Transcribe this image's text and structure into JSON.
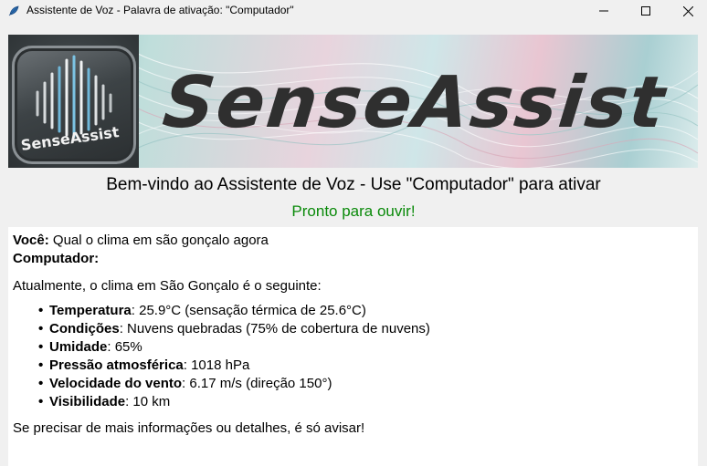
{
  "window": {
    "title": "Assistente de Voz - Palavra de ativação: \"Computador\"",
    "controls": {
      "minimize": "minimize-icon",
      "maximize": "maximize-icon",
      "close": "close-icon"
    }
  },
  "banner": {
    "logo_text": "SenseAssist",
    "title": "SenseAssist"
  },
  "welcome": "Bem-vindo ao Assistente de Voz - Use \"Computador\" para ativar",
  "status": {
    "text": "Pronto para ouvir!",
    "color": "#0a8a0a"
  },
  "chat": {
    "user_label": "Você:",
    "user_message": "Qual o clima em são gonçalo agora",
    "assistant_label": "Computador:",
    "intro": "Atualmente, o clima em São Gonçalo é o seguinte:",
    "details": [
      {
        "label": "Temperatura",
        "value": ": 25.9°C (sensação térmica de 25.6°C)"
      },
      {
        "label": "Condições",
        "value": ": Nuvens quebradas (75% de cobertura de nuvens)"
      },
      {
        "label": "Umidade",
        "value": ": 65%"
      },
      {
        "label": "Pressão atmosférica",
        "value": ": 1018 hPa"
      },
      {
        "label": "Velocidade do vento",
        "value": ": 6.17 m/s (direção 150°)"
      },
      {
        "label": "Visibilidade",
        "value": ": 10 km"
      }
    ],
    "closing": "Se precisar de mais informações ou detalhes, é só avisar!"
  }
}
